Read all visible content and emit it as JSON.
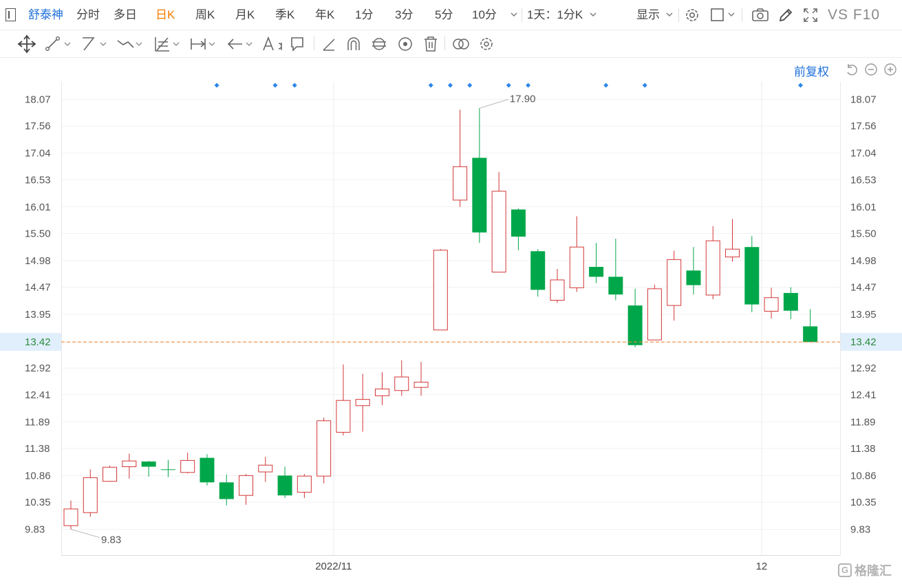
{
  "header": {
    "stock_name": "舒泰神",
    "tabs": [
      "分时",
      "多日",
      "日K",
      "周K",
      "月K",
      "季K",
      "年K",
      "1分",
      "3分",
      "5分",
      "10分"
    ],
    "active_tab": "日K",
    "period_select": "1天：1分K",
    "display_label": "显示",
    "f10_label": "VS F10"
  },
  "toolbar": {
    "tools": [
      "move-tool",
      "line-tool",
      "channel-tool",
      "polyline-tool",
      "fib-tool",
      "measure-tool",
      "arrow-tool",
      "text-tool",
      "comment-tool",
      "pen-tool",
      "magnet-tool",
      "sync-tool",
      "eye-tool",
      "delete-tool",
      "compare-tool",
      "settings-tool"
    ]
  },
  "adjust_label": "前复权",
  "watermark": "格隆汇",
  "colors": {
    "up": "#d33535",
    "down": "#00a74a",
    "current_line": "#f08a3c",
    "marker": "#2b87e8",
    "accent": "#f57c00",
    "link": "#1e6fd9"
  },
  "chart_data": {
    "type": "candlestick",
    "y_ticks": [
      "18.07",
      "17.56",
      "17.04",
      "16.53",
      "16.01",
      "15.50",
      "14.98",
      "14.47",
      "13.95",
      "13.42",
      "12.92",
      "12.41",
      "11.89",
      "11.38",
      "10.86",
      "10.35",
      "9.83"
    ],
    "x_ticks": [
      {
        "label": "2022/11",
        "index": 13.5
      },
      {
        "label": "12",
        "index": 35.5
      }
    ],
    "current_price": "13.42",
    "max_label": {
      "value": "17.90",
      "index": 21
    },
    "min_label": {
      "value": "9.83",
      "index": 0
    },
    "event_markers": [
      7.5,
      10.5,
      11.5,
      18.5,
      19.5,
      20.5,
      22.5,
      23.5,
      27.5,
      29.5,
      37.5
    ],
    "candles": [
      {
        "o": 9.9,
        "h": 10.38,
        "l": 9.83,
        "c": 10.22
      },
      {
        "o": 10.15,
        "h": 10.98,
        "l": 10.07,
        "c": 10.82
      },
      {
        "o": 10.75,
        "h": 11.05,
        "l": 10.74,
        "c": 11.02
      },
      {
        "o": 11.03,
        "h": 11.28,
        "l": 10.8,
        "c": 11.14
      },
      {
        "o": 11.13,
        "h": 11.14,
        "l": 10.84,
        "c": 11.03
      },
      {
        "o": 10.98,
        "h": 11.16,
        "l": 10.83,
        "c": 10.97
      },
      {
        "o": 10.92,
        "h": 11.3,
        "l": 10.9,
        "c": 11.15
      },
      {
        "o": 11.2,
        "h": 11.27,
        "l": 10.67,
        "c": 10.73
      },
      {
        "o": 10.73,
        "h": 10.88,
        "l": 10.29,
        "c": 10.41
      },
      {
        "o": 10.48,
        "h": 10.89,
        "l": 10.3,
        "c": 10.86
      },
      {
        "o": 10.93,
        "h": 11.22,
        "l": 10.74,
        "c": 11.06
      },
      {
        "o": 10.86,
        "h": 11.03,
        "l": 10.43,
        "c": 10.48
      },
      {
        "o": 10.54,
        "h": 10.89,
        "l": 10.43,
        "c": 10.85
      },
      {
        "o": 10.85,
        "h": 11.97,
        "l": 10.71,
        "c": 11.91
      },
      {
        "o": 11.69,
        "h": 12.99,
        "l": 11.63,
        "c": 12.3
      },
      {
        "o": 12.2,
        "h": 12.81,
        "l": 11.7,
        "c": 12.32
      },
      {
        "o": 12.39,
        "h": 12.84,
        "l": 12.21,
        "c": 12.52
      },
      {
        "o": 12.49,
        "h": 13.07,
        "l": 12.39,
        "c": 12.75
      },
      {
        "o": 12.55,
        "h": 13.04,
        "l": 12.39,
        "c": 12.65
      },
      {
        "o": 13.65,
        "h": 15.2,
        "l": 13.65,
        "c": 15.18
      },
      {
        "o": 16.14,
        "h": 17.87,
        "l": 16.01,
        "c": 16.78
      },
      {
        "o": 16.95,
        "h": 17.9,
        "l": 15.32,
        "c": 15.52
      },
      {
        "o": 14.76,
        "h": 16.68,
        "l": 14.76,
        "c": 16.31
      },
      {
        "o": 15.96,
        "h": 15.98,
        "l": 15.18,
        "c": 15.44
      },
      {
        "o": 15.16,
        "h": 15.2,
        "l": 14.29,
        "c": 14.42
      },
      {
        "o": 14.22,
        "h": 14.82,
        "l": 14.17,
        "c": 14.61
      },
      {
        "o": 14.46,
        "h": 15.83,
        "l": 14.38,
        "c": 15.24
      },
      {
        "o": 14.86,
        "h": 15.32,
        "l": 14.55,
        "c": 14.67
      },
      {
        "o": 14.67,
        "h": 15.4,
        "l": 14.22,
        "c": 14.33
      },
      {
        "o": 14.12,
        "h": 14.44,
        "l": 13.32,
        "c": 13.36
      },
      {
        "o": 13.46,
        "h": 14.52,
        "l": 13.46,
        "c": 14.44
      },
      {
        "o": 14.12,
        "h": 15.17,
        "l": 13.83,
        "c": 15.0
      },
      {
        "o": 14.79,
        "h": 15.24,
        "l": 14.33,
        "c": 14.51
      },
      {
        "o": 14.32,
        "h": 15.64,
        "l": 14.24,
        "c": 15.36
      },
      {
        "o": 15.05,
        "h": 15.78,
        "l": 14.96,
        "c": 15.2
      },
      {
        "o": 15.24,
        "h": 15.45,
        "l": 13.99,
        "c": 14.14
      },
      {
        "o": 14.01,
        "h": 14.46,
        "l": 13.87,
        "c": 14.27
      },
      {
        "o": 14.36,
        "h": 14.47,
        "l": 13.86,
        "c": 14.02
      },
      {
        "o": 13.72,
        "h": 14.05,
        "l": 13.41,
        "c": 13.42
      }
    ]
  }
}
